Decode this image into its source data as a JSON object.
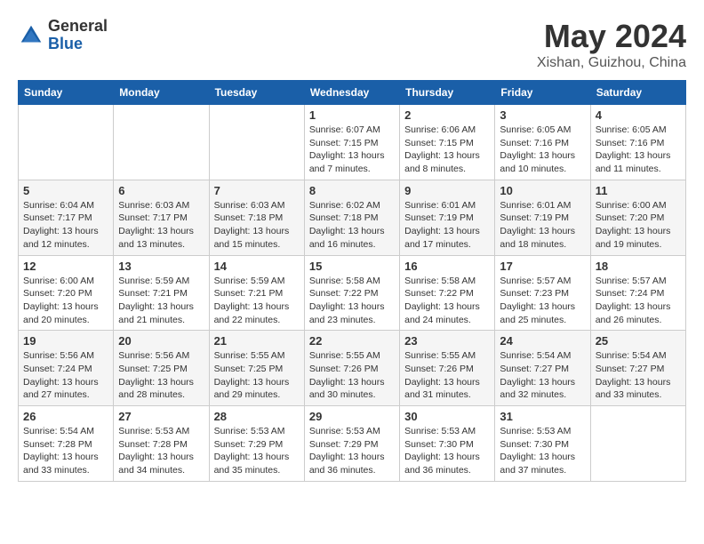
{
  "logo": {
    "general": "General",
    "blue": "Blue"
  },
  "title": "May 2024",
  "location": "Xishan, Guizhou, China",
  "weekdays": [
    "Sunday",
    "Monday",
    "Tuesday",
    "Wednesday",
    "Thursday",
    "Friday",
    "Saturday"
  ],
  "weeks": [
    [
      {
        "day": "",
        "info": ""
      },
      {
        "day": "",
        "info": ""
      },
      {
        "day": "",
        "info": ""
      },
      {
        "day": "1",
        "info": "Sunrise: 6:07 AM\nSunset: 7:15 PM\nDaylight: 13 hours\nand 7 minutes."
      },
      {
        "day": "2",
        "info": "Sunrise: 6:06 AM\nSunset: 7:15 PM\nDaylight: 13 hours\nand 8 minutes."
      },
      {
        "day": "3",
        "info": "Sunrise: 6:05 AM\nSunset: 7:16 PM\nDaylight: 13 hours\nand 10 minutes."
      },
      {
        "day": "4",
        "info": "Sunrise: 6:05 AM\nSunset: 7:16 PM\nDaylight: 13 hours\nand 11 minutes."
      }
    ],
    [
      {
        "day": "5",
        "info": "Sunrise: 6:04 AM\nSunset: 7:17 PM\nDaylight: 13 hours\nand 12 minutes."
      },
      {
        "day": "6",
        "info": "Sunrise: 6:03 AM\nSunset: 7:17 PM\nDaylight: 13 hours\nand 13 minutes."
      },
      {
        "day": "7",
        "info": "Sunrise: 6:03 AM\nSunset: 7:18 PM\nDaylight: 13 hours\nand 15 minutes."
      },
      {
        "day": "8",
        "info": "Sunrise: 6:02 AM\nSunset: 7:18 PM\nDaylight: 13 hours\nand 16 minutes."
      },
      {
        "day": "9",
        "info": "Sunrise: 6:01 AM\nSunset: 7:19 PM\nDaylight: 13 hours\nand 17 minutes."
      },
      {
        "day": "10",
        "info": "Sunrise: 6:01 AM\nSunset: 7:19 PM\nDaylight: 13 hours\nand 18 minutes."
      },
      {
        "day": "11",
        "info": "Sunrise: 6:00 AM\nSunset: 7:20 PM\nDaylight: 13 hours\nand 19 minutes."
      }
    ],
    [
      {
        "day": "12",
        "info": "Sunrise: 6:00 AM\nSunset: 7:20 PM\nDaylight: 13 hours\nand 20 minutes."
      },
      {
        "day": "13",
        "info": "Sunrise: 5:59 AM\nSunset: 7:21 PM\nDaylight: 13 hours\nand 21 minutes."
      },
      {
        "day": "14",
        "info": "Sunrise: 5:59 AM\nSunset: 7:21 PM\nDaylight: 13 hours\nand 22 minutes."
      },
      {
        "day": "15",
        "info": "Sunrise: 5:58 AM\nSunset: 7:22 PM\nDaylight: 13 hours\nand 23 minutes."
      },
      {
        "day": "16",
        "info": "Sunrise: 5:58 AM\nSunset: 7:22 PM\nDaylight: 13 hours\nand 24 minutes."
      },
      {
        "day": "17",
        "info": "Sunrise: 5:57 AM\nSunset: 7:23 PM\nDaylight: 13 hours\nand 25 minutes."
      },
      {
        "day": "18",
        "info": "Sunrise: 5:57 AM\nSunset: 7:24 PM\nDaylight: 13 hours\nand 26 minutes."
      }
    ],
    [
      {
        "day": "19",
        "info": "Sunrise: 5:56 AM\nSunset: 7:24 PM\nDaylight: 13 hours\nand 27 minutes."
      },
      {
        "day": "20",
        "info": "Sunrise: 5:56 AM\nSunset: 7:25 PM\nDaylight: 13 hours\nand 28 minutes."
      },
      {
        "day": "21",
        "info": "Sunrise: 5:55 AM\nSunset: 7:25 PM\nDaylight: 13 hours\nand 29 minutes."
      },
      {
        "day": "22",
        "info": "Sunrise: 5:55 AM\nSunset: 7:26 PM\nDaylight: 13 hours\nand 30 minutes."
      },
      {
        "day": "23",
        "info": "Sunrise: 5:55 AM\nSunset: 7:26 PM\nDaylight: 13 hours\nand 31 minutes."
      },
      {
        "day": "24",
        "info": "Sunrise: 5:54 AM\nSunset: 7:27 PM\nDaylight: 13 hours\nand 32 minutes."
      },
      {
        "day": "25",
        "info": "Sunrise: 5:54 AM\nSunset: 7:27 PM\nDaylight: 13 hours\nand 33 minutes."
      }
    ],
    [
      {
        "day": "26",
        "info": "Sunrise: 5:54 AM\nSunset: 7:28 PM\nDaylight: 13 hours\nand 33 minutes."
      },
      {
        "day": "27",
        "info": "Sunrise: 5:53 AM\nSunset: 7:28 PM\nDaylight: 13 hours\nand 34 minutes."
      },
      {
        "day": "28",
        "info": "Sunrise: 5:53 AM\nSunset: 7:29 PM\nDaylight: 13 hours\nand 35 minutes."
      },
      {
        "day": "29",
        "info": "Sunrise: 5:53 AM\nSunset: 7:29 PM\nDaylight: 13 hours\nand 36 minutes."
      },
      {
        "day": "30",
        "info": "Sunrise: 5:53 AM\nSunset: 7:30 PM\nDaylight: 13 hours\nand 36 minutes."
      },
      {
        "day": "31",
        "info": "Sunrise: 5:53 AM\nSunset: 7:30 PM\nDaylight: 13 hours\nand 37 minutes."
      },
      {
        "day": "",
        "info": ""
      }
    ]
  ]
}
